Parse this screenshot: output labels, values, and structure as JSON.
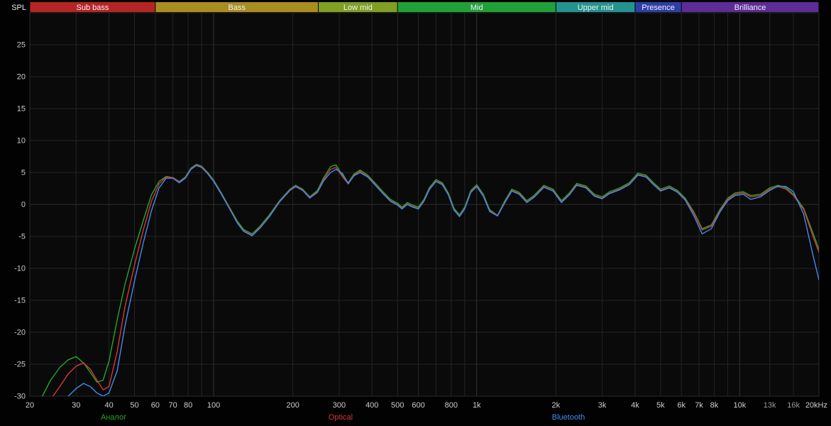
{
  "chart_data": {
    "type": "line",
    "title": "",
    "xlabel": "",
    "ylabel": "SPL",
    "x_scale": "log",
    "x_range": [
      20,
      20000
    ],
    "y_range": [
      -30,
      30
    ],
    "y_step": 5,
    "grid": true,
    "y_ticks": [
      25,
      20,
      15,
      10,
      5,
      0,
      -5,
      -10,
      -15,
      -20,
      -25,
      -30
    ],
    "x_ticks": [
      {
        "f": 20,
        "label": "20"
      },
      {
        "f": 30,
        "label": "30"
      },
      {
        "f": 40,
        "label": "40"
      },
      {
        "f": 50,
        "label": "50"
      },
      {
        "f": 60,
        "label": "60"
      },
      {
        "f": 70,
        "label": "70"
      },
      {
        "f": 80,
        "label": "80"
      },
      {
        "f": 90,
        "label": ""
      },
      {
        "f": 100,
        "label": "100"
      },
      {
        "f": 200,
        "label": "200"
      },
      {
        "f": 300,
        "label": "300"
      },
      {
        "f": 400,
        "label": "400"
      },
      {
        "f": 500,
        "label": "500"
      },
      {
        "f": 600,
        "label": "600"
      },
      {
        "f": 700,
        "label": ""
      },
      {
        "f": 800,
        "label": "800"
      },
      {
        "f": 900,
        "label": ""
      },
      {
        "f": 1000,
        "label": "1k"
      },
      {
        "f": 2000,
        "label": "2k"
      },
      {
        "f": 3000,
        "label": "3k"
      },
      {
        "f": 4000,
        "label": "4k"
      },
      {
        "f": 5000,
        "label": "5k"
      },
      {
        "f": 6000,
        "label": "6k"
      },
      {
        "f": 7000,
        "label": "7k"
      },
      {
        "f": 8000,
        "label": "8k"
      },
      {
        "f": 9000,
        "label": ""
      },
      {
        "f": 10000,
        "label": "10k"
      },
      {
        "f": 13000,
        "label": "13k",
        "dim": true
      },
      {
        "f": 16000,
        "label": "16k",
        "dim": true
      },
      {
        "f": 20000,
        "label": "20kHz"
      }
    ],
    "bands": [
      {
        "label": "Sub bass",
        "color": "#b62525",
        "from": 20,
        "to": 60
      },
      {
        "label": "Bass",
        "color": "#a88d20",
        "from": 60,
        "to": 250
      },
      {
        "label": "Low mid",
        "color": "#7fa024",
        "from": 250,
        "to": 500
      },
      {
        "label": "Mid",
        "color": "#22a038",
        "from": 500,
        "to": 2000
      },
      {
        "label": "Upper mid",
        "color": "#23938f",
        "from": 2000,
        "to": 4000
      },
      {
        "label": "Presence",
        "color": "#2e3ea8",
        "from": 4000,
        "to": 6000
      },
      {
        "label": "Brilliance",
        "color": "#5e2c96",
        "from": 6000,
        "to": 20000
      }
    ],
    "legend_position": "bottom",
    "legend": [
      {
        "label": "Аналог",
        "x": 160,
        "series": "analog"
      },
      {
        "label": "Optical",
        "x": 480,
        "series": "optical"
      },
      {
        "label": "Bluetooth",
        "x": 801,
        "series": "bluetooth"
      }
    ],
    "x": [
      20,
      22,
      24,
      26,
      28,
      30,
      32,
      34,
      36,
      38,
      40,
      43,
      46,
      50,
      54,
      58,
      62,
      66,
      70,
      74,
      78,
      82,
      86,
      90,
      95,
      100,
      107,
      115,
      123,
      130,
      140,
      150,
      163,
      178,
      195,
      205,
      218,
      232,
      248,
      262,
      278,
      292,
      308,
      325,
      342,
      360,
      385,
      410,
      440,
      470,
      500,
      520,
      545,
      570,
      600,
      630,
      660,
      700,
      740,
      780,
      820,
      860,
      900,
      950,
      1000,
      1060,
      1120,
      1200,
      1280,
      1360,
      1450,
      1550,
      1650,
      1800,
      1950,
      2100,
      2250,
      2400,
      2600,
      2800,
      3000,
      3200,
      3500,
      3800,
      4100,
      4400,
      4700,
      5000,
      5400,
      5800,
      6200,
      6700,
      7200,
      7800,
      8400,
      9000,
      9600,
      10300,
      11000,
      12000,
      13000,
      14000,
      15000,
      16000,
      17500,
      19000,
      20000
    ],
    "series": [
      {
        "id": "analog",
        "name": "Аналог",
        "color": "#25a52a",
        "values": [
          -31,
          -30.5,
          -27.5,
          -25.5,
          -24.3,
          -23.8,
          -24.8,
          -26.3,
          -27.8,
          -27.5,
          -24.5,
          -18,
          -12.5,
          -7,
          -2.5,
          1.5,
          3.6,
          4.4,
          4.2,
          3.6,
          4.3,
          5.7,
          6.3,
          6.0,
          5.0,
          3.8,
          1.8,
          -0.5,
          -2.6,
          -3.9,
          -4.6,
          -3.4,
          -1.6,
          0.6,
          2.4,
          3.0,
          2.4,
          1.2,
          2.2,
          4.2,
          5.9,
          6.2,
          4.6,
          3.4,
          4.8,
          5.4,
          4.6,
          3.4,
          2.0,
          0.8,
          0.2,
          -0.4,
          0.3,
          -0.1,
          -0.4,
          0.8,
          2.6,
          3.9,
          3.4,
          1.8,
          -0.6,
          -1.6,
          -0.4,
          2.2,
          3.1,
          1.6,
          -0.8,
          -1.7,
          0.6,
          2.4,
          1.9,
          0.6,
          1.4,
          3.0,
          2.4,
          0.6,
          1.8,
          3.3,
          2.9,
          1.6,
          1.2,
          2.0,
          2.6,
          3.4,
          4.9,
          4.6,
          3.4,
          2.4,
          2.9,
          2.2,
          1.0,
          -1.2,
          -3.8,
          -3.2,
          -0.8,
          1.0,
          1.8,
          2.0,
          1.4,
          1.6,
          2.6,
          3.0,
          2.6,
          1.6,
          -0.6,
          -4.5,
          -7.0
        ]
      },
      {
        "id": "optical",
        "name": "Optical",
        "color": "#d93636",
        "values": [
          -33,
          -32,
          -30.5,
          -28.5,
          -26.5,
          -25.3,
          -24.8,
          -25.8,
          -27.5,
          -29.0,
          -28.5,
          -23,
          -16,
          -9.5,
          -4,
          0.5,
          3.2,
          4.3,
          4.2,
          3.5,
          4.2,
          5.6,
          6.2,
          5.9,
          4.9,
          3.7,
          1.7,
          -0.6,
          -2.8,
          -4.1,
          -4.8,
          -3.6,
          -1.8,
          0.5,
          2.3,
          2.9,
          2.3,
          1.1,
          2.0,
          3.9,
          5.5,
          5.8,
          4.4,
          3.2,
          4.6,
          5.2,
          4.4,
          3.2,
          1.8,
          0.6,
          0.0,
          -0.6,
          0.1,
          -0.3,
          -0.6,
          0.6,
          2.4,
          3.7,
          3.2,
          1.6,
          -0.8,
          -1.8,
          -0.6,
          2.0,
          2.9,
          1.4,
          -1.0,
          -1.7,
          0.4,
          2.2,
          1.7,
          0.4,
          1.2,
          2.8,
          2.2,
          0.4,
          1.6,
          3.1,
          2.7,
          1.4,
          1.0,
          1.8,
          2.4,
          3.2,
          4.7,
          4.4,
          3.2,
          2.2,
          2.7,
          2.0,
          0.8,
          -1.4,
          -4.0,
          -3.4,
          -1.0,
          0.8,
          1.6,
          1.8,
          1.2,
          1.4,
          2.4,
          2.8,
          2.4,
          1.4,
          -0.8,
          -5.0,
          -7.5
        ]
      },
      {
        "id": "bluetooth",
        "name": "Bluetooth",
        "color": "#3f8cf0",
        "values": [
          -33,
          -33,
          -32.5,
          -31.5,
          -30.0,
          -28.8,
          -28.0,
          -28.5,
          -29.5,
          -30.0,
          -29.5,
          -26,
          -19,
          -12,
          -6,
          -1,
          2.6,
          4.1,
          4.1,
          3.4,
          4.1,
          5.5,
          6.1,
          5.8,
          4.8,
          3.6,
          1.6,
          -0.7,
          -2.9,
          -4.2,
          -4.9,
          -3.7,
          -1.9,
          0.4,
          2.2,
          2.8,
          2.2,
          1.0,
          1.9,
          3.7,
          5.0,
          5.5,
          4.9,
          3.3,
          4.5,
          5.0,
          4.3,
          3.1,
          1.7,
          0.5,
          -0.1,
          -0.7,
          0.0,
          -0.4,
          -0.7,
          0.5,
          2.3,
          3.6,
          3.1,
          1.5,
          -0.9,
          -1.9,
          -0.7,
          1.9,
          2.8,
          1.3,
          -1.1,
          -1.8,
          0.3,
          2.1,
          1.6,
          0.3,
          1.1,
          2.7,
          2.1,
          0.3,
          1.5,
          3.0,
          2.6,
          1.3,
          0.9,
          1.7,
          2.3,
          3.1,
          4.6,
          4.3,
          3.1,
          2.1,
          2.6,
          1.9,
          0.7,
          -1.8,
          -4.6,
          -3.8,
          -1.2,
          0.6,
          1.4,
          1.6,
          0.8,
          1.2,
          2.2,
          2.9,
          2.8,
          2.0,
          -1.5,
          -8.0,
          -11.8
        ]
      }
    ]
  }
}
